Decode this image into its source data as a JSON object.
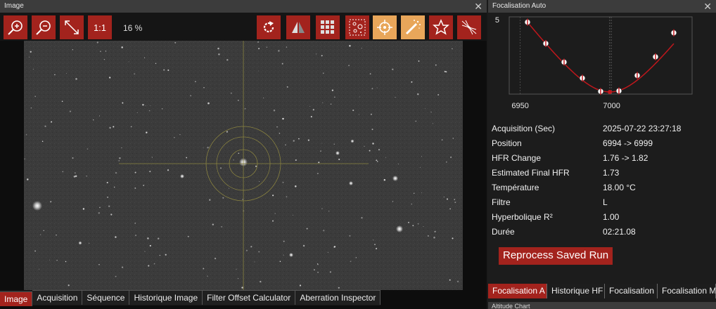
{
  "image_panel": {
    "title": "Image",
    "close_icon": "close-icon",
    "zoom_level": "16 %",
    "one_to_one_label": "1:1",
    "tabs": [
      {
        "label": "Image",
        "active": true
      },
      {
        "label": "Acquisition"
      },
      {
        "label": "Séquence"
      },
      {
        "label": "Historique Image"
      },
      {
        "label": "Filter Offset Calculator"
      },
      {
        "label": "Aberration Inspector"
      }
    ]
  },
  "focus_panel": {
    "title": "Focalisation Auto",
    "chart_data": {
      "type": "scatter",
      "x_ticks": [
        "6950",
        "7000"
      ],
      "y_ticks": [
        "5"
      ],
      "x": [
        6954,
        6964,
        6974,
        6984,
        6994,
        7004,
        7014,
        7024,
        7034
      ],
      "y": [
        4.95,
        4.55,
        4.2,
        3.9,
        3.65,
        3.66,
        3.95,
        4.3,
        4.75
      ],
      "fit_min_x": 6999,
      "xlim": [
        6944,
        7044
      ],
      "ylim": [
        3.6,
        5.05
      ],
      "colors": {
        "curve": "#c0171c",
        "points": "#ffffff",
        "grid": "#555555"
      }
    },
    "rows": [
      {
        "key": "Acquisition (Sec)",
        "value": "2025-07-22 23:27:18"
      },
      {
        "key": "Position",
        "value": "6994 -> 6999"
      },
      {
        "key": "HFR Change",
        "value": "1.76 -> 1.82"
      },
      {
        "key": "Estimated Final HFR",
        "value": "1.73"
      },
      {
        "key": "Température",
        "value": "18.00 °C"
      },
      {
        "key": "Filtre",
        "value": "L"
      },
      {
        "key": "Hyperbolique R²",
        "value": "1.00"
      },
      {
        "key": "Durée",
        "value": "02:21.08"
      }
    ],
    "reprocess_label": "Reprocess Saved Run",
    "tabs": [
      {
        "label": "Focalisation A",
        "active": true
      },
      {
        "label": "Historique HF"
      },
      {
        "label": "Focalisation"
      },
      {
        "label": "Focalisation M"
      }
    ]
  },
  "altitude_panel": {
    "title": "Altitude Chart"
  }
}
